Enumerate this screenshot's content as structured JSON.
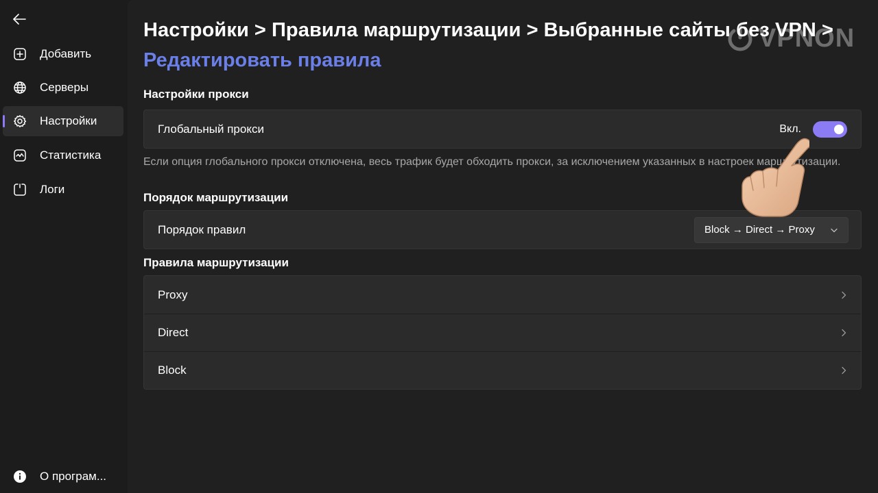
{
  "sidebar": {
    "items": [
      {
        "label": "Добавить",
        "icon": "add-square-icon"
      },
      {
        "label": "Серверы",
        "icon": "globe-icon"
      },
      {
        "label": "Настройки",
        "icon": "gear-icon",
        "active": true
      },
      {
        "label": "Статистика",
        "icon": "chart-icon"
      },
      {
        "label": "Логи",
        "icon": "log-icon"
      }
    ],
    "about_label": "О програм..."
  },
  "header": {
    "breadcrumb": [
      "Настройки",
      "Правила маршрутизации",
      "Выбранные сайты без VPN"
    ],
    "separator": ">",
    "current": "Редактировать правила"
  },
  "watermark": {
    "text": "VPNON"
  },
  "proxy_settings": {
    "title": "Настройки прокси",
    "global_proxy_label": "Глобальный прокси",
    "toggle_state_label": "Вкл.",
    "toggle_on": true,
    "description": "Если опция глобального прокси отключена, весь трафик будет обходить прокси, за исключением указанных в настроек маршрутизации."
  },
  "routing_order": {
    "title": "Порядок маршрутизации",
    "label": "Порядок правил",
    "selected": "Block → Direct → Proxy"
  },
  "routing_rules": {
    "title": "Правила маршрутизации",
    "items": [
      "Proxy",
      "Direct",
      "Block"
    ]
  },
  "colors": {
    "accent": "#8b7cf6",
    "page_title": "#6b7fe8",
    "background": "#202020",
    "card": "#2b2b2b"
  }
}
